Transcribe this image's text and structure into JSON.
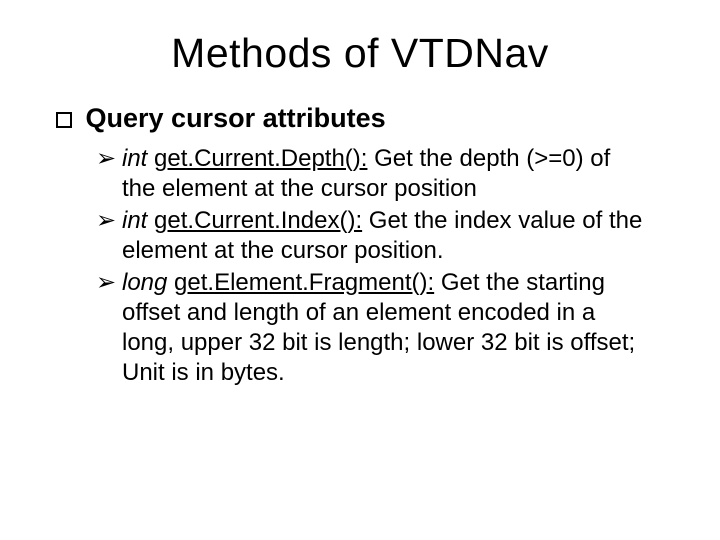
{
  "title": "Methods of VTDNav",
  "section_heading": "Query cursor attributes",
  "items": [
    {
      "ret": "int",
      "method": "get.Current.Depth():",
      "desc_lead": " Get the depth ",
      "desc_rest": "(>=0) of the element at the cursor position"
    },
    {
      "ret": "int",
      "method": "get.Current.Index():",
      "desc_lead": " Get the index value ",
      "desc_rest": "of the element at the cursor position."
    },
    {
      "ret": "long",
      "method": "get.Element.Fragment():",
      "desc_lead": " Get the ",
      "desc_rest": "starting offset and length of an element encoded in a long, upper 32 bit is length; lower 32 bit is offset; Unit is in bytes."
    }
  ],
  "arrow": "➢"
}
